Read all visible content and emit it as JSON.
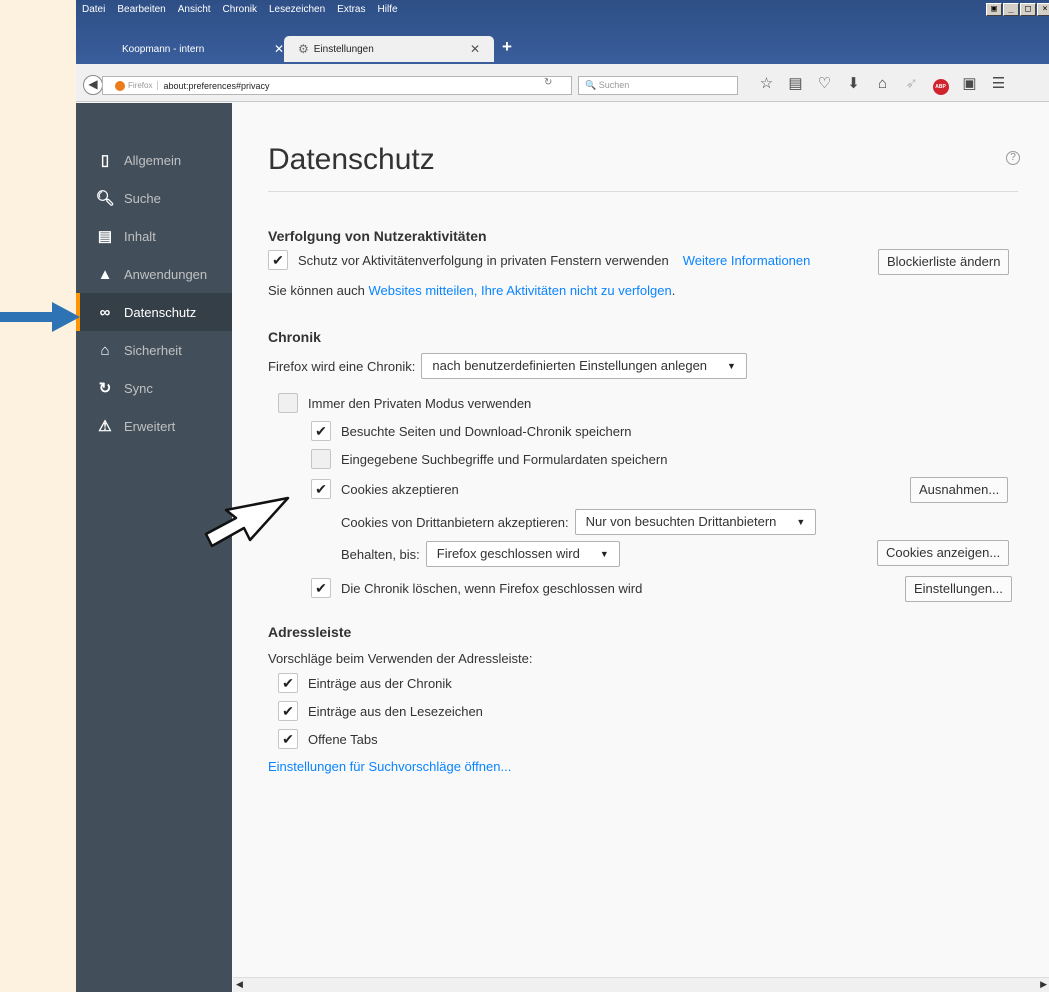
{
  "menu": [
    "Datei",
    "Bearbeiten",
    "Ansicht",
    "Chronik",
    "Lesezeichen",
    "Extras",
    "Hilfe"
  ],
  "tabs": [
    {
      "label": "Koopmann - intern",
      "active": false
    },
    {
      "label": "Einstellungen",
      "active": true
    }
  ],
  "newtab_label": "+",
  "urlbar": {
    "identity": "Firefox",
    "url": "about:preferences#privacy"
  },
  "searchbar": {
    "placeholder": "Suchen"
  },
  "toolbar_icons": [
    "star-icon",
    "bookmarks-icon",
    "pocket-icon",
    "download-icon",
    "home-icon",
    "send-icon",
    "adblock-icon",
    "extension-icon",
    "menu-icon"
  ],
  "toolbar_abp": "ABP",
  "sidebar": {
    "items": [
      {
        "label": "Allgemein",
        "icon": "general-icon"
      },
      {
        "label": "Suche",
        "icon": "search-icon"
      },
      {
        "label": "Inhalt",
        "icon": "content-icon"
      },
      {
        "label": "Anwendungen",
        "icon": "applications-icon"
      },
      {
        "label": "Datenschutz",
        "icon": "privacy-mask-icon",
        "selected": true
      },
      {
        "label": "Sicherheit",
        "icon": "security-icon"
      },
      {
        "label": "Sync",
        "icon": "sync-icon"
      },
      {
        "label": "Erweitert",
        "icon": "advanced-icon"
      }
    ]
  },
  "page": {
    "title": "Datenschutz",
    "help": "?",
    "tracking": {
      "heading": "Verfolgung von Nutzeraktivitäten",
      "protection_label": "Schutz vor Aktivitätenverfolgung in privaten Fenstern verwenden",
      "protection_checked": true,
      "more_info": "Weitere Informationen",
      "blocklist_button": "Blockierliste ändern",
      "dnt_prefix": "Sie können auch",
      "dnt_link": "Websites mitteilen, Ihre Aktivitäten nicht zu verfolgen",
      "dnt_suffix": "."
    },
    "history": {
      "heading": "Chronik",
      "mode_label": "Firefox wird eine Chronik:",
      "mode_value": "nach benutzerdefinierten Einstellungen anlegen",
      "private_mode": {
        "label": "Immer den Privaten Modus verwenden",
        "checked": false
      },
      "remember_history": {
        "label": "Besuchte Seiten und Download-Chronik speichern",
        "checked": true
      },
      "remember_forms": {
        "label": "Eingegebene Suchbegriffe und Formulardaten speichern",
        "checked": false
      },
      "accept_cookies": {
        "label": "Cookies akzeptieren",
        "checked": true
      },
      "exceptions_button": "Ausnahmen...",
      "third_party_label": "Cookies von Drittanbietern akzeptieren:",
      "third_party_value": "Nur von besuchten Drittanbietern",
      "keep_until_label": "Behalten, bis:",
      "keep_until_value": "Firefox geschlossen wird",
      "show_cookies_button": "Cookies anzeigen...",
      "clear_on_close": {
        "label": "Die Chronik löschen, wenn Firefox geschlossen wird",
        "checked": true
      },
      "settings_button": "Einstellungen..."
    },
    "locationbar": {
      "heading": "Adressleiste",
      "intro": "Vorschläge beim Verwenden der Adressleiste:",
      "history": {
        "label": "Einträge aus der Chronik",
        "checked": true
      },
      "bookmarks": {
        "label": "Einträge aus den Lesezeichen",
        "checked": true
      },
      "open_tabs": {
        "label": "Offene Tabs",
        "checked": true
      },
      "suggest_link": "Einstellungen für Suchvorschläge öffnen..."
    }
  },
  "colors": {
    "annotation_arrow": "#2e74b5",
    "sidebar_bg": "#424f5a",
    "accent": "#ff9500",
    "link": "#0a84ff"
  }
}
